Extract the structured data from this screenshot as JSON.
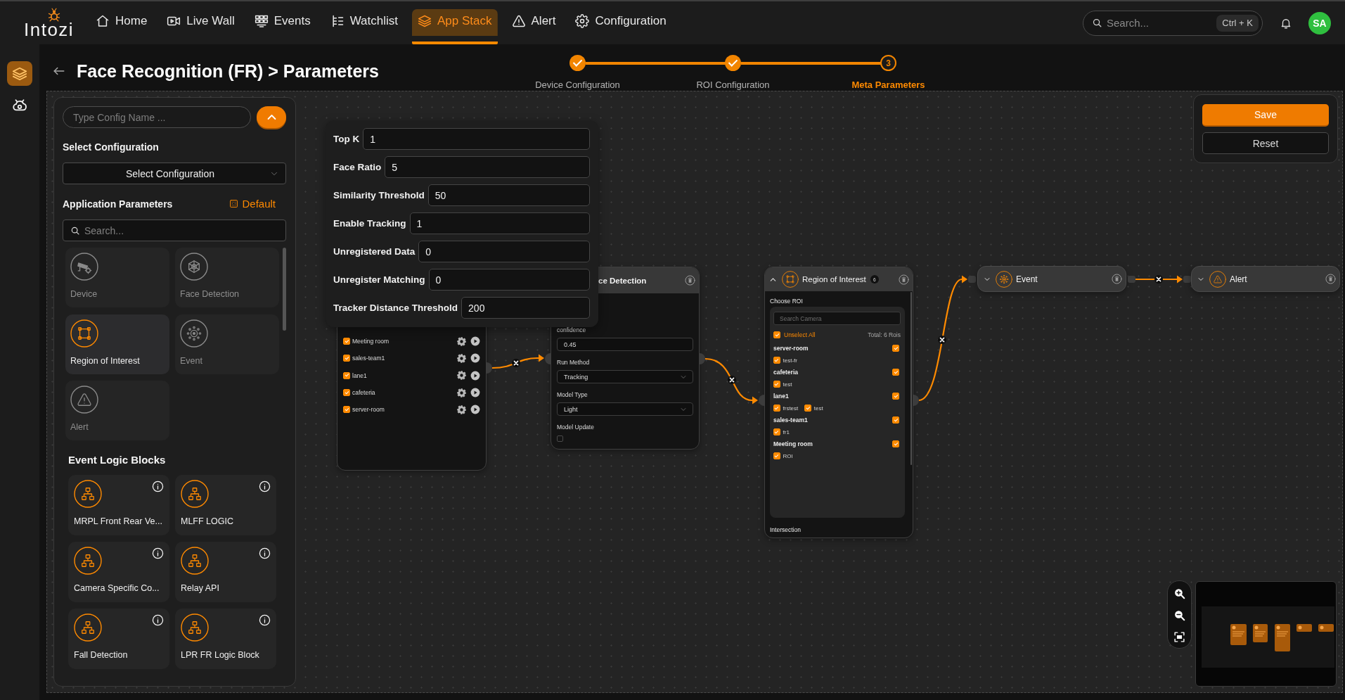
{
  "top_nav": {
    "logo": "Intozi",
    "items": [
      {
        "label": "Home",
        "selected": false
      },
      {
        "label": "Live Wall",
        "selected": false
      },
      {
        "label": "Events",
        "selected": false
      },
      {
        "label": "Watchlist",
        "selected": false
      },
      {
        "label": "App Stack",
        "selected": true
      },
      {
        "label": "Alert",
        "selected": false
      },
      {
        "label": "Configuration",
        "selected": false
      }
    ],
    "search": {
      "placeholder": "Search...",
      "shortcut": "Ctrl + K"
    },
    "avatar": "SA"
  },
  "side_rail": [
    {
      "selected": true
    },
    {
      "selected": false
    }
  ],
  "header": {
    "title": "Face Recognition (FR) > Parameters",
    "steps": [
      {
        "label": "Device Configuration",
        "completed": true,
        "selected": false
      },
      {
        "label": "ROI Configuration",
        "completed": true,
        "selected": false
      },
      {
        "label": "Meta Parameters",
        "number": "3",
        "completed": false,
        "selected": true
      }
    ]
  },
  "sidebar": {
    "config_name": {
      "placeholder": "Type Config Name ..."
    },
    "select_label": "Select Configuration",
    "select": {
      "value": "Select Configuration"
    },
    "parameters_title": "Application Parameters",
    "default_button": "Default",
    "search": {
      "placeholder": "Search..."
    },
    "parameters": [
      {
        "label": "Device",
        "selected": false
      },
      {
        "label": "Face Detection",
        "selected": false
      },
      {
        "label": "Region of Interest",
        "selected": true
      },
      {
        "label": "Event",
        "selected": false
      },
      {
        "label": "Alert",
        "selected": false
      }
    ],
    "logic_title": "Event Logic Blocks",
    "logic_blocks": [
      {
        "label": "MRPL Front Rear Ve..."
      },
      {
        "label": "MLFF LOGIC"
      },
      {
        "label": "Camera Specific Co..."
      },
      {
        "label": "Relay API"
      },
      {
        "label": "Fall Detection"
      },
      {
        "label": "LPR FR Logic Block"
      }
    ]
  },
  "parameters_popup": [
    {
      "label": "Top K",
      "value": "1"
    },
    {
      "label": "Face Ratio",
      "value": "5"
    },
    {
      "label": "Similarity Threshold",
      "value": "50"
    },
    {
      "label": "Enable Tracking",
      "value": "1"
    },
    {
      "label": "Unregistered Data",
      "value": "0"
    },
    {
      "label": "Unregister Matching",
      "value": "0"
    },
    {
      "label": "Tracker Distance Threshold",
      "value": "200"
    }
  ],
  "canvas": {
    "device_node": {
      "cameras": [
        {
          "label": "Meeting room",
          "checked": true
        },
        {
          "label": "sales-team1",
          "checked": true
        },
        {
          "label": "lane1",
          "checked": true
        },
        {
          "label": "cafeteria",
          "checked": true
        },
        {
          "label": "server-room",
          "checked": true
        }
      ]
    },
    "face_detection_node": {
      "title": "ce Detection",
      "fields": [
        {
          "kind": "input",
          "label": "confidence",
          "value": "0.45"
        },
        {
          "kind": "select",
          "label": "Run Method",
          "value": "Tracking"
        },
        {
          "kind": "select",
          "label": "Model Type",
          "value": "Light"
        },
        {
          "kind": "checkbox",
          "label": "Model Update",
          "checked": false
        }
      ]
    },
    "roi_node": {
      "title": "Region of Interest",
      "badge": "6",
      "expanded": true,
      "choose_label": "Choose ROI",
      "search": {
        "placeholder": "Search Camera"
      },
      "select_all": {
        "label": "Unselect All",
        "checked": true
      },
      "total": "Total: 6 Rois",
      "cameras": [
        {
          "name": "server-room",
          "checked": true,
          "rois": [
            {
              "label": "test-fr",
              "checked": true
            }
          ]
        },
        {
          "name": "cafeteria",
          "checked": true,
          "rois": [
            {
              "label": "test",
              "checked": true
            }
          ]
        },
        {
          "name": "lane1",
          "checked": true,
          "rois": [
            {
              "label": "frstest",
              "checked": true
            },
            {
              "label": "test",
              "checked": true
            }
          ]
        },
        {
          "name": "sales-team1",
          "checked": true,
          "rois": [
            {
              "label": "fr1",
              "checked": true
            }
          ]
        },
        {
          "name": "Meeting room",
          "checked": true,
          "rois": [
            {
              "label": "ROI",
              "checked": true
            }
          ]
        }
      ],
      "footer_label": "Intersection"
    },
    "event_node": {
      "title": "Event",
      "expanded": false
    },
    "alert_node": {
      "title": "Alert",
      "expanded": false
    }
  },
  "actions": [
    {
      "label": "Save",
      "kind": "primary"
    },
    {
      "label": "Reset",
      "kind": "secondary"
    }
  ]
}
